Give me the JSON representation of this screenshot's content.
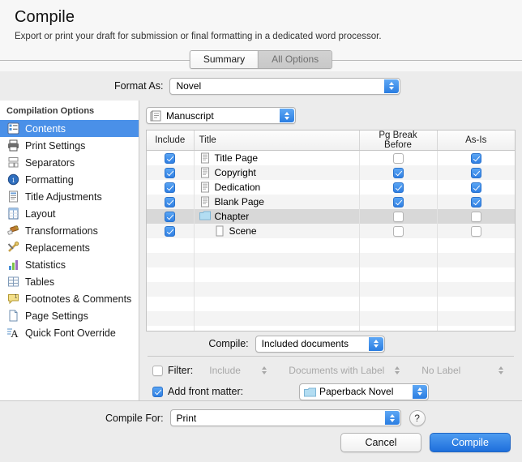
{
  "dialog": {
    "title": "Compile",
    "subtitle": "Export or print your draft for submission or final formatting in a dedicated word processor."
  },
  "tabs": [
    {
      "label": "Summary",
      "active": false
    },
    {
      "label": "All Options",
      "active": true
    }
  ],
  "format_as": {
    "label": "Format As:",
    "value": "Novel"
  },
  "sidebar": {
    "header": "Compilation Options",
    "items": [
      {
        "label": "Contents",
        "icon": "contents-icon",
        "selected": true
      },
      {
        "label": "Print Settings",
        "icon": "printer-icon",
        "selected": false
      },
      {
        "label": "Separators",
        "icon": "separators-icon",
        "selected": false
      },
      {
        "label": "Formatting",
        "icon": "formatting-icon",
        "selected": false
      },
      {
        "label": "Title Adjustments",
        "icon": "title-doc-icon",
        "selected": false
      },
      {
        "label": "Layout",
        "icon": "layout-icon",
        "selected": false
      },
      {
        "label": "Transformations",
        "icon": "transformations-icon",
        "selected": false
      },
      {
        "label": "Replacements",
        "icon": "replacements-icon",
        "selected": false
      },
      {
        "label": "Statistics",
        "icon": "statistics-icon",
        "selected": false
      },
      {
        "label": "Tables",
        "icon": "tables-icon",
        "selected": false
      },
      {
        "label": "Footnotes & Comments",
        "icon": "footnote-icon",
        "selected": false
      },
      {
        "label": "Page Settings",
        "icon": "page-settings-icon",
        "selected": false
      },
      {
        "label": "Quick Font Override",
        "icon": "font-override-icon",
        "selected": false
      }
    ]
  },
  "contents": {
    "source": {
      "value": "Manuscript",
      "icon": "manuscript-icon"
    },
    "columns": [
      "Include",
      "Title",
      "Pg Break Before",
      "As-Is"
    ],
    "rows": [
      {
        "include": true,
        "title": "Title Page",
        "icon": "document-icon",
        "indent": false,
        "pg_break_before": false,
        "as_is": true,
        "selected": false
      },
      {
        "include": true,
        "title": "Copyright",
        "icon": "document-icon",
        "indent": false,
        "pg_break_before": true,
        "as_is": true,
        "selected": false
      },
      {
        "include": true,
        "title": "Dedication",
        "icon": "document-icon",
        "indent": false,
        "pg_break_before": true,
        "as_is": true,
        "selected": false
      },
      {
        "include": true,
        "title": "Blank Page",
        "icon": "document-icon",
        "indent": false,
        "pg_break_before": true,
        "as_is": true,
        "selected": false
      },
      {
        "include": true,
        "title": "Chapter",
        "icon": "folder-icon",
        "indent": false,
        "pg_break_before": false,
        "as_is": false,
        "selected": true
      },
      {
        "include": true,
        "title": "Scene",
        "icon": "blank-doc-icon",
        "indent": true,
        "pg_break_before": false,
        "as_is": false,
        "selected": false
      }
    ],
    "empty_row_count": 10,
    "compile": {
      "label": "Compile:",
      "value": "Included documents"
    },
    "filter": {
      "label": "Filter:",
      "checked": false,
      "mode": "Include",
      "criterion": "Documents with Label",
      "value": "No Label"
    },
    "front_matter": {
      "label": "Add front matter:",
      "checked": true,
      "value": "Paperback Novel",
      "icon": "folder-icon"
    }
  },
  "footer": {
    "compile_for": {
      "label": "Compile For:",
      "value": "Print"
    },
    "help_label": "?",
    "cancel_label": "Cancel",
    "compile_label": "Compile"
  },
  "colors": {
    "accent": "#2f7fe3",
    "selection": "#4a90e8",
    "row_selection": "#d8d8d8",
    "window_bg": "#ececec",
    "header_bg": "#f7f7f7"
  }
}
